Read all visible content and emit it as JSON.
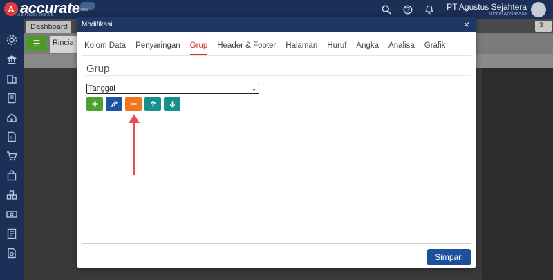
{
  "app": {
    "logo_mark": "A",
    "logo_text": "accurate",
    "logo_suffix": "online",
    "version": "v5.3.4 2026 0 0308 215",
    "company_name": "PT Agustus Sejahtera",
    "user_name": "Michel Aprilaaaaa"
  },
  "background": {
    "tab_dashboard": "Dashboard",
    "tab_rincian": "Rincia",
    "tab_select_value": "3"
  },
  "modal": {
    "title": "Modifikasi",
    "close": "×",
    "tabs": [
      {
        "label": "Kolom Data"
      },
      {
        "label": "Penyaringan"
      },
      {
        "label": "Grup"
      },
      {
        "label": "Header & Footer"
      },
      {
        "label": "Halaman"
      },
      {
        "label": "Huruf"
      },
      {
        "label": "Angka"
      },
      {
        "label": "Analisa"
      },
      {
        "label": "Grafik"
      }
    ],
    "active_tab": "Grup",
    "section_title": "Grup",
    "group_select_value": "Tanggal",
    "actions": {
      "add": "plus-icon",
      "edit": "pencil-icon",
      "remove": "minus-icon",
      "move_up": "arrow-up-icon",
      "move_down": "arrow-down-icon"
    },
    "save_label": "Simpan"
  },
  "colors": {
    "header": "#1e3765",
    "accent_active": "#d9322c",
    "add": "#4ea12e",
    "edit": "#1e52a3",
    "remove": "#f0761c",
    "move": "#16908a",
    "save": "#1e4f9f",
    "annotation_arrow": "#e84c4c"
  }
}
